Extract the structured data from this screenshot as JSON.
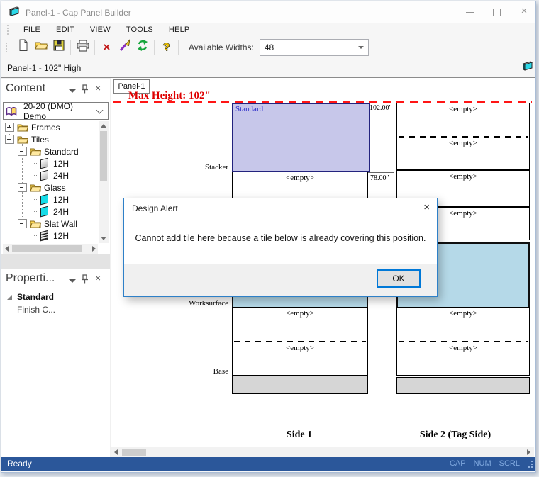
{
  "window": {
    "title": "Panel-1 - Cap Panel Builder",
    "controls": [
      "minimize",
      "maximize",
      "close"
    ]
  },
  "menu": [
    "FILE",
    "EDIT",
    "VIEW",
    "TOOLS",
    "HELP"
  ],
  "toolbar": {
    "icons": [
      "new",
      "open",
      "save",
      "print",
      "delete",
      "format-painter",
      "refresh",
      "help"
    ],
    "available_widths_label": "Available Widths:",
    "available_widths_value": "48"
  },
  "panel_caption": "Panel-1 - 102\" High",
  "content_panel": {
    "title": "Content",
    "library_selector": "20-20 (DMO) Demo",
    "tree": [
      {
        "label": "Frames",
        "icon": "folder",
        "expander": "+"
      },
      {
        "label": "Tiles",
        "icon": "folder",
        "expander": "-"
      },
      {
        "label": "Standard",
        "icon": "folder",
        "expander": "-"
      },
      {
        "label": "12H",
        "icon": "tile-standard"
      },
      {
        "label": "24H",
        "icon": "tile-standard"
      },
      {
        "label": "Glass",
        "icon": "folder",
        "expander": "-"
      },
      {
        "label": "12H",
        "icon": "tile-glass"
      },
      {
        "label": "24H",
        "icon": "tile-glass"
      },
      {
        "label": "Slat Wall",
        "icon": "folder",
        "expander": "-"
      },
      {
        "label": "12H",
        "icon": "tile-slatwall"
      }
    ]
  },
  "properties_panel": {
    "title": "Properti...",
    "group_label": "Standard",
    "property_label": "Finish C..."
  },
  "canvas": {
    "tab_label": "Panel-1",
    "max_height_label": "Max Height: 102\"",
    "dim_102": "102.00\"",
    "dim_78": "78.00\"",
    "row_labels": {
      "stacker": "Stacker",
      "worksurface": "Worksurface",
      "base": "Base"
    },
    "tile_standard_label": "Standard",
    "empty_label": "<empty>",
    "side1_label": "Side 1",
    "side2_label": "Side 2 (Tag Side)",
    "colors": {
      "standard_tile_fill": "#c7c7ea",
      "glass_tile_fill": "#b5d9e8",
      "base_fill": "#d6d6d6",
      "max_height_red": "#de0000"
    }
  },
  "dialog": {
    "title": "Design Alert",
    "message": "Cannot add tile here because a tile below is already covering this position.",
    "ok_label": "OK"
  },
  "status": {
    "ready": "Ready",
    "indicators": [
      "CAP",
      "NUM",
      "SCRL"
    ],
    "bar_color": "#2b579a"
  }
}
